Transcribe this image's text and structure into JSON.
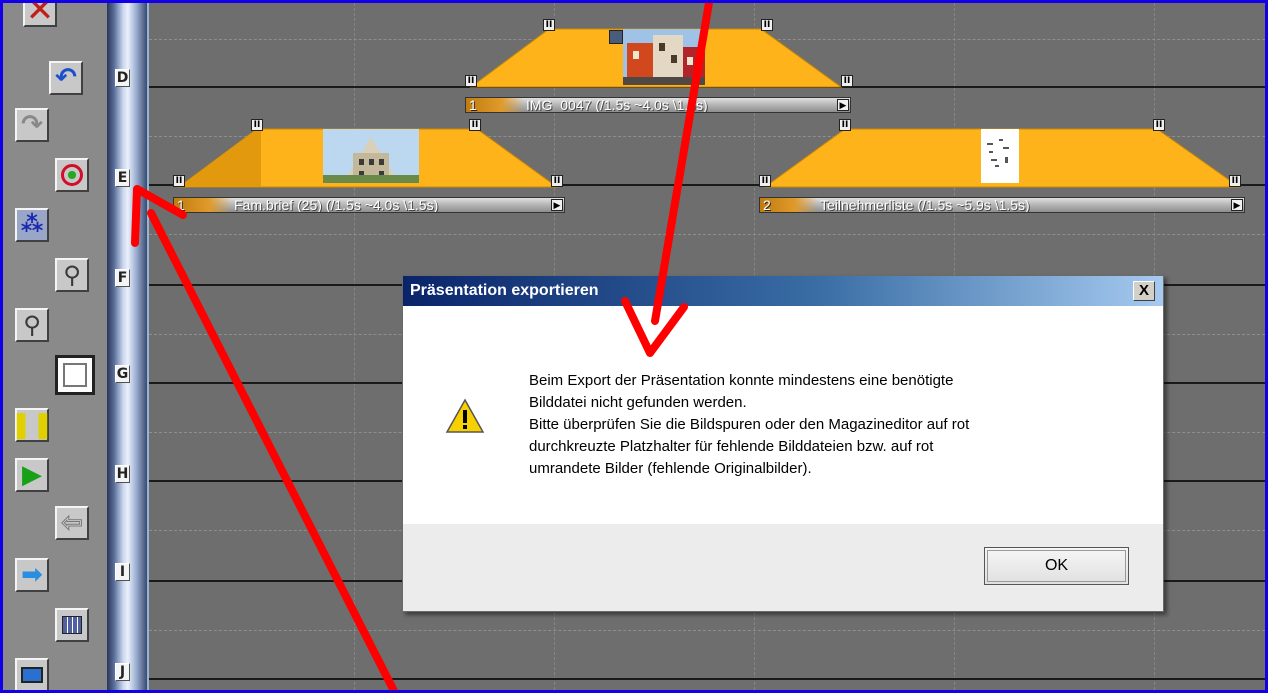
{
  "tracks": {
    "letters": [
      "D",
      "E",
      "F",
      "G",
      "H",
      "I",
      "J"
    ]
  },
  "clips": [
    {
      "number": "1",
      "label": "IMG_0047 (/1.5s ~4.0s \\1.5s)"
    },
    {
      "number": "1",
      "label": "Fam.brief (25) (/1.5s ~4.0s \\1.5s)"
    },
    {
      "number": "2",
      "label": "Teilnehmerliste (/1.5s ~5.9s \\1.5s)"
    }
  ],
  "toolbar": {
    "icons": [
      "delete-icon",
      "undo-icon",
      "redo-icon",
      "group-icon",
      "ungroup-icon",
      "zoom-in-icon",
      "zoom-out-icon",
      "frame-icon",
      "pause-icon",
      "play-icon",
      "back-icon",
      "forward-icon",
      "calendar-icon",
      "monitor-icon"
    ]
  },
  "dialog": {
    "title": "Präsentation exportieren",
    "close_glyph": "X",
    "message_lines": [
      "Beim Export der Präsentation konnte mindestens eine benötigte",
      "Bilddatei nicht gefunden werden.",
      "Bitte überprüfen Sie die Bildspuren oder den Magazineditor auf rot",
      "durchkreuzte Platzhalter für fehlende Bilddateien bzw. auf rot",
      "umrandete Bilder (fehlende Originalbilder)."
    ],
    "ok_label": "OK"
  },
  "colors": {
    "frame_border": "#1400e6",
    "clip_fill": "#ffb31a",
    "annotation_arrow": "#ff0000",
    "dialog_title_start": "#0a246a",
    "dialog_title_end": "#a6caf0"
  }
}
